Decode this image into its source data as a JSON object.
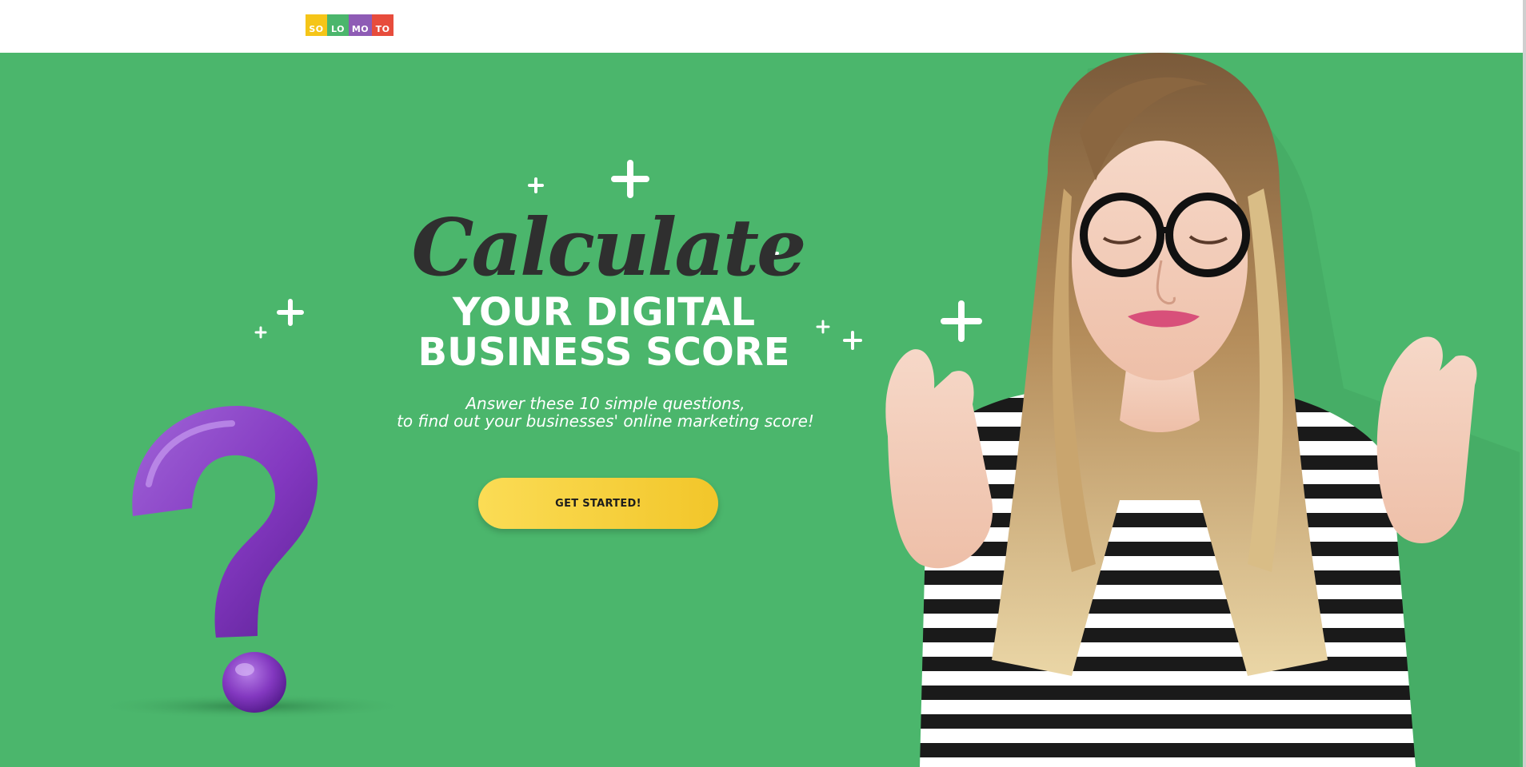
{
  "logo": {
    "segments": [
      {
        "text": "SO",
        "color": "#f5c518"
      },
      {
        "text": "LO",
        "color": "#4bb66c"
      },
      {
        "text": "MO",
        "color": "#8e5bb5"
      },
      {
        "text": "TO",
        "color": "#e74c3c"
      }
    ]
  },
  "hero": {
    "background_color": "#4bb66c",
    "headline_script": "Calculate",
    "headline_line1": "YOUR DIGITAL",
    "headline_line2": "BUSINESS SCORE",
    "subtitle_line1": "Answer these 10 simple questions,",
    "subtitle_line2": "to find out your businesses' online marketing score!",
    "cta_label": "GET STARTED!",
    "cta_color": "#f2c62a",
    "question_mark_color": "#8a3fc2",
    "question_icon": "question-mark-3d",
    "person_image": "woman-crossed-fingers"
  }
}
